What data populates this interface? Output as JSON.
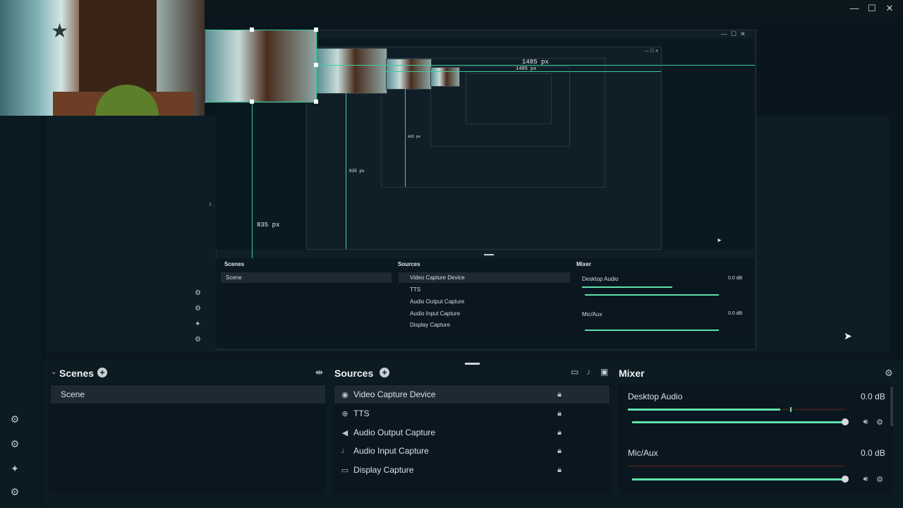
{
  "window": {
    "minimize": "—",
    "maximize": "☐",
    "close": "✕"
  },
  "preview": {
    "guides": {
      "width_label": "1485 px",
      "height_label": "835 px"
    },
    "collapse_arrow": "›"
  },
  "nested": {
    "scenes_title": "Scenes",
    "scene_item": "Scene",
    "sources_title": "Sources",
    "sources": [
      "Video Capture Device",
      "TTS",
      "Audio Output Capture",
      "Audio Input Capture",
      "Display Capture"
    ],
    "mixer_title": "Mixer",
    "desktop_audio": "Desktop Audio",
    "desktop_db": "0.0 dB",
    "mic_aux": "Mic/Aux",
    "mic_db": "0.0 dB"
  },
  "docks": {
    "scenes": {
      "title": "Scenes",
      "items": [
        "Scene"
      ]
    },
    "sources": {
      "title": "Sources",
      "items": [
        {
          "label": "Video Capture Device",
          "icon": "camera-icon"
        },
        {
          "label": "TTS",
          "icon": "globe-icon"
        },
        {
          "label": "Audio Output Capture",
          "icon": "speaker-icon"
        },
        {
          "label": "Audio Input Capture",
          "icon": "microphone-icon"
        },
        {
          "label": "Display Capture",
          "icon": "monitor-icon"
        }
      ]
    },
    "mixer": {
      "title": "Mixer",
      "channels": [
        {
          "name": "Desktop Audio",
          "db": "0.0 dB",
          "level": 0.7,
          "volume": 1.0
        },
        {
          "name": "Mic/Aux",
          "db": "0.0 dB",
          "level": 0.0,
          "volume": 1.0
        }
      ]
    }
  },
  "colors": {
    "accent": "#5fe0a8",
    "background": "#09161e",
    "panel": "#0a1620"
  }
}
